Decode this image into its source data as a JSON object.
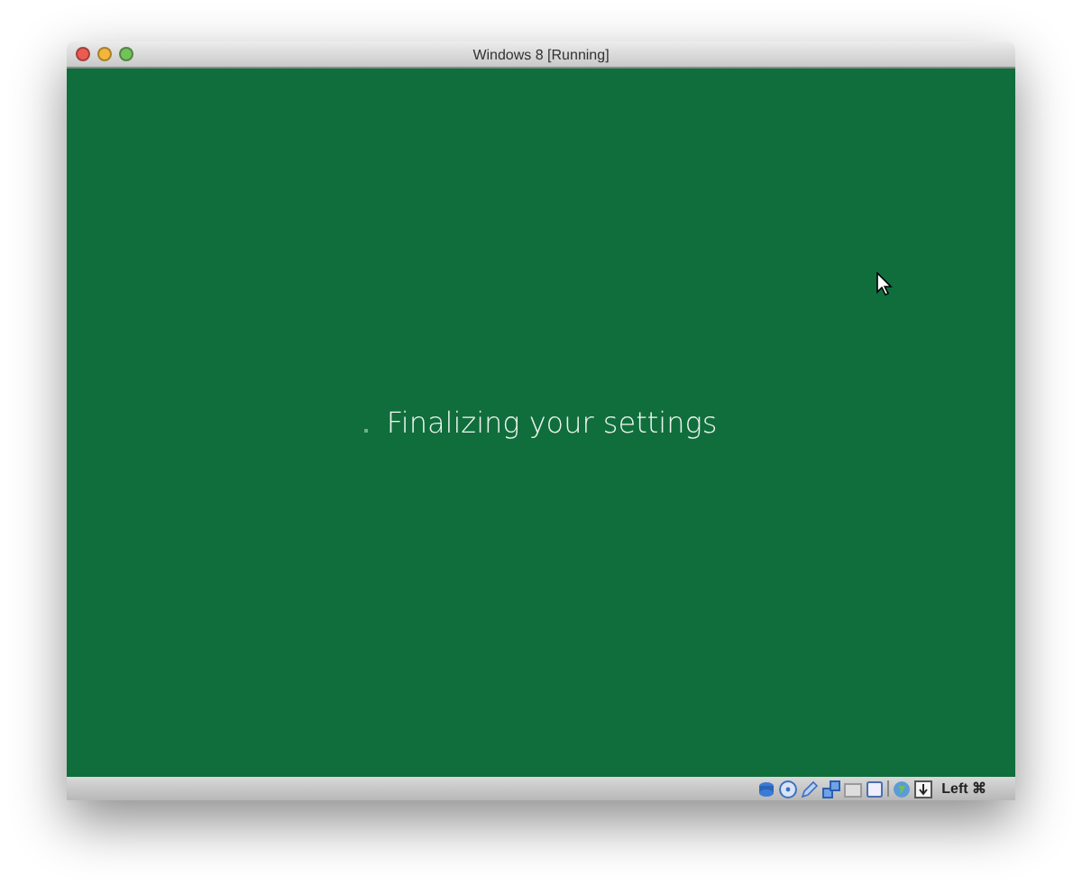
{
  "window": {
    "title": "Windows 8 [Running]"
  },
  "screen": {
    "message": "Finalizing your settings"
  },
  "status_bar": {
    "host_key": "Left ⌘"
  }
}
